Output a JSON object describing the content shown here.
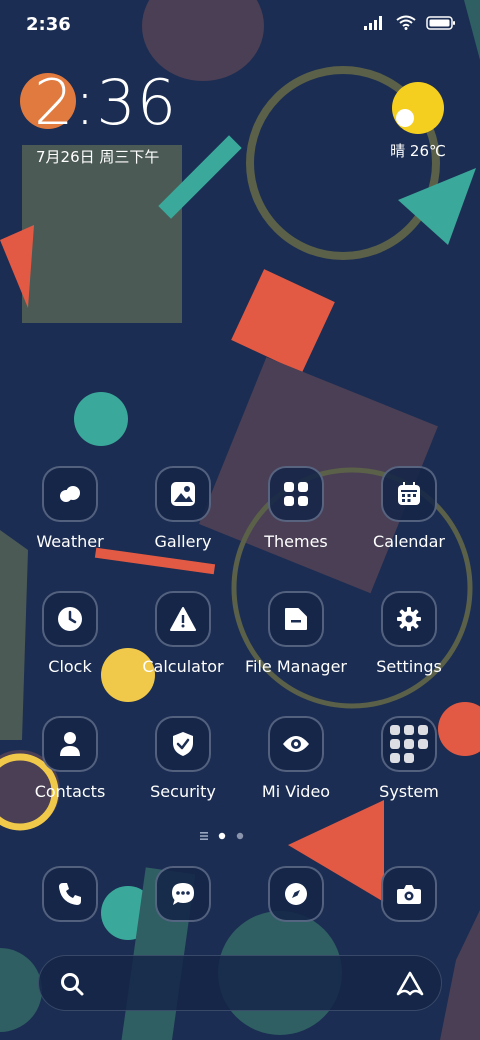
{
  "status_bar": {
    "time": "2:36",
    "icons": [
      "signal-icon",
      "wifi-icon",
      "battery-icon"
    ]
  },
  "clock_widget": {
    "time": "2:36",
    "date": "7月26日 周三下午"
  },
  "weather_widget": {
    "condition_icon": "sun-cloud-icon",
    "text": "晴 26℃"
  },
  "apps": [
    [
      {
        "label": "Weather",
        "icon": "weather-icon"
      },
      {
        "label": "Gallery",
        "icon": "gallery-icon"
      },
      {
        "label": "Themes",
        "icon": "themes-icon"
      },
      {
        "label": "Calendar",
        "icon": "calendar-icon"
      }
    ],
    [
      {
        "label": "Clock",
        "icon": "clock-icon"
      },
      {
        "label": "Calculator",
        "icon": "calculator-icon"
      },
      {
        "label": "File Manager",
        "icon": "file-manager-icon"
      },
      {
        "label": "Settings",
        "icon": "settings-icon"
      }
    ],
    [
      {
        "label": "Contacts",
        "icon": "contacts-icon"
      },
      {
        "label": "Security",
        "icon": "security-icon"
      },
      {
        "label": "Mi Video",
        "icon": "mi-video-icon"
      },
      {
        "label": "System",
        "icon": "system-folder-icon"
      }
    ]
  ],
  "page_indicator": {
    "pages": 2,
    "current": 1
  },
  "dock": [
    "phone-icon",
    "messages-icon",
    "browser-icon",
    "camera-icon"
  ],
  "search_bar": {
    "left_icon": "search-icon",
    "right_icon": "assistant-icon"
  },
  "colors": {
    "background": "#1b2d52",
    "accent_orange": "#e25a43",
    "accent_teal": "#3aa89a",
    "accent_yellow": "#f0c94a"
  }
}
